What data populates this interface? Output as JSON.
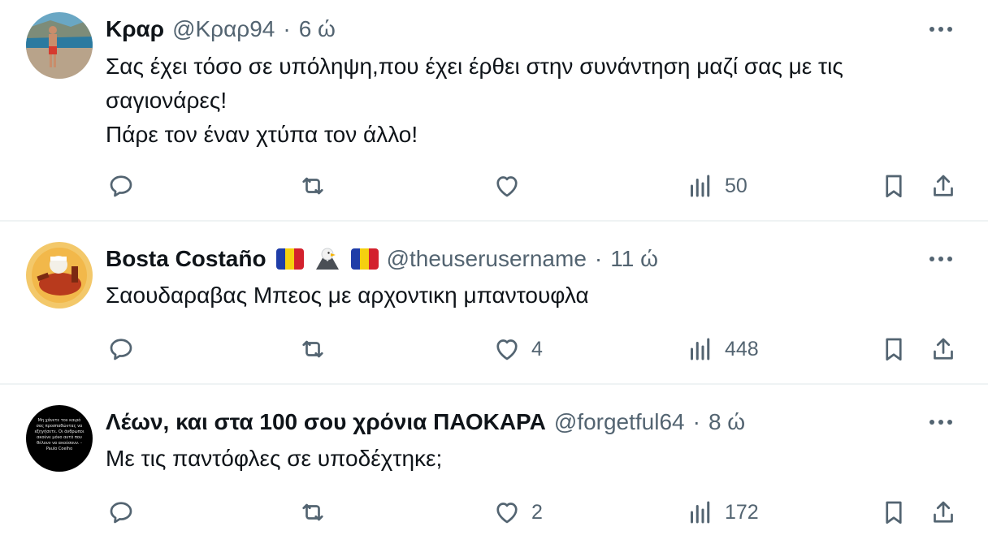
{
  "tweets": [
    {
      "name": "Κραρ",
      "handle": "@Κραρ94",
      "separator": "·",
      "time": "6 ώ",
      "body_lines": [
        "Σας έχει τόσο σε υπόληψη,που έχει έρθει στην συνάντηση μαζί σας με τις",
        "σαγιονάρες!",
        "Πάρε τον έναν χτύπα τον άλλο!"
      ],
      "reply_count": "",
      "retweet_count": "",
      "like_count": "",
      "views": "50"
    },
    {
      "name": "Bosta Costaño",
      "handle": "@theuserusername",
      "separator": "·",
      "time": "11 ώ",
      "body_lines": [
        "Σαουδαραβας Μπεος με αρχοντικη μπαντουφλα"
      ],
      "reply_count": "",
      "retweet_count": "",
      "like_count": "4",
      "views": "448"
    },
    {
      "name": "Λέων, και στα 100 σου χρόνια ΠΑΟΚΑΡΑ",
      "handle": "@forgetful64",
      "separator": "·",
      "time": "8 ώ",
      "body_lines": [
        "Με τις παντόφλες σε υποδέχτηκε;"
      ],
      "reply_count": "",
      "retweet_count": "",
      "like_count": "2",
      "views": "172"
    }
  ],
  "avatar3_quote_text": "Μη χάνετε τον καιρό σας προσπαθώντας να εξηγήσετε. Οι άνθρωποι ακούνε μόνο αυτό που θέλουν να ακούσουν. - Paulo Coelho",
  "colors": {
    "text": "#0f1419",
    "muted": "#536471",
    "divider": "#eff3f4",
    "flag_blue": "#1f3da8",
    "flag_yellow": "#f5d00f",
    "flag_red": "#d3212d"
  },
  "icons": [
    "more-icon",
    "reply-icon",
    "retweet-icon",
    "like-icon",
    "views-icon",
    "bookmark-icon",
    "share-icon",
    "romania-flag-icon",
    "eagle-icon"
  ]
}
